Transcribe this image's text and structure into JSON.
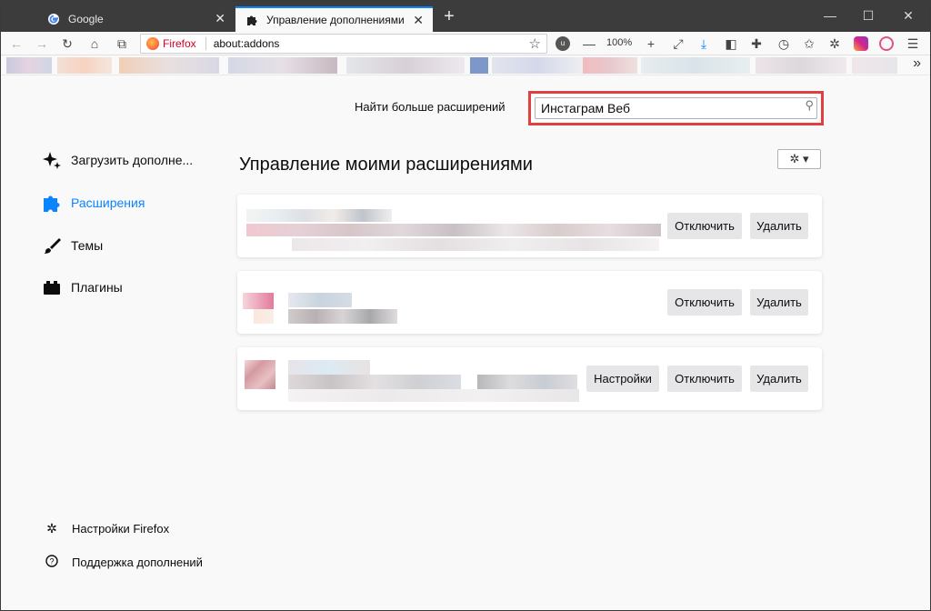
{
  "tabs": [
    {
      "label": "Google",
      "active": false
    },
    {
      "label": "Управление дополнениями",
      "active": true
    }
  ],
  "navbar": {
    "identity_label": "Firefox",
    "url": "about:addons",
    "zoom": "100%"
  },
  "search": {
    "label": "Найти больше расширений",
    "value": "Инстаграм Веб"
  },
  "sidebar": {
    "items": [
      {
        "label": "Загрузить дополне...",
        "icon": "sparkle-icon"
      },
      {
        "label": "Расширения",
        "icon": "puzzle-icon",
        "selected": true
      },
      {
        "label": "Темы",
        "icon": "brush-icon"
      },
      {
        "label": "Плагины",
        "icon": "plugin-icon"
      }
    ],
    "footer": [
      {
        "label": "Настройки Firefox",
        "icon": "gear-icon"
      },
      {
        "label": "Поддержка дополнений",
        "icon": "help-icon"
      }
    ]
  },
  "main": {
    "heading": "Управление моими расширениями",
    "cards": [
      {
        "buttons": [
          "Отключить",
          "Удалить"
        ]
      },
      {
        "buttons": [
          "Отключить",
          "Удалить"
        ]
      },
      {
        "buttons": [
          "Настройки",
          "Отключить",
          "Удалить"
        ]
      }
    ]
  },
  "colors": {
    "accent": "#0a84ff",
    "highlight_box": "#e0403f"
  }
}
